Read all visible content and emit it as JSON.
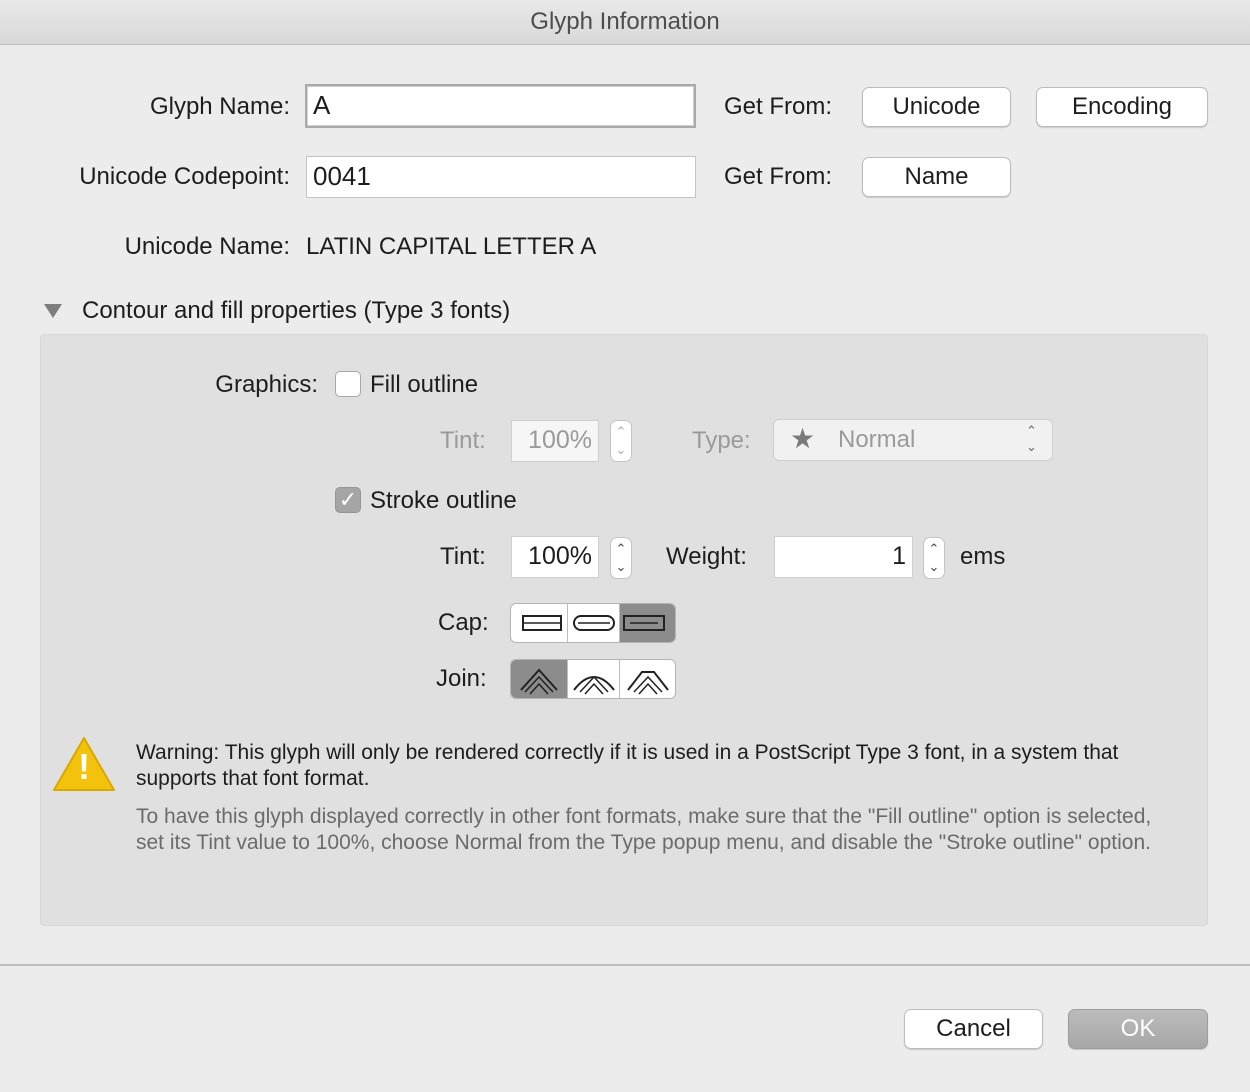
{
  "window": {
    "title": "Glyph Information"
  },
  "glyph_name": {
    "label": "Glyph Name:",
    "value": "A"
  },
  "get_from_1": {
    "label": "Get From:",
    "unicode_button": "Unicode",
    "encoding_button": "Encoding"
  },
  "codepoint": {
    "label": "Unicode Codepoint:",
    "value": "0041"
  },
  "get_from_2": {
    "label": "Get From:",
    "name_button": "Name"
  },
  "unicode_name": {
    "label": "Unicode Name:",
    "value": "LATIN CAPITAL LETTER A"
  },
  "section": {
    "title": "Contour and fill properties (Type 3 fonts)",
    "expanded": true
  },
  "graphics": {
    "label": "Graphics:",
    "fill_outline": {
      "label": "Fill outline",
      "checked": false
    },
    "fill_tint": {
      "label": "Tint:",
      "value": "100%"
    },
    "fill_type": {
      "label": "Type:",
      "value": "Normal",
      "icon": "star-icon"
    },
    "stroke_outline": {
      "label": "Stroke outline",
      "checked": true,
      "check_glyph": "✓"
    },
    "stroke_tint": {
      "label": "Tint:",
      "value": "100%"
    },
    "weight": {
      "label": "Weight:",
      "value": "1",
      "unit": "ems"
    },
    "cap": {
      "label": "Cap:",
      "options": [
        "butt-cap-icon",
        "round-cap-icon",
        "square-cap-icon"
      ],
      "selected": 2
    },
    "join": {
      "label": "Join:",
      "options": [
        "miter-join-icon",
        "round-join-icon",
        "bevel-join-icon"
      ],
      "selected": 0
    }
  },
  "warning": {
    "icon": "warning-icon",
    "icon_glyph": "!",
    "primary": "Warning: This glyph will only be rendered correctly if it is used in a PostScript Type 3 font, in a system that supports that font format.",
    "secondary": "To have this glyph displayed correctly in other font formats, make sure that the \"Fill outline\" option is selected, set its Tint value to 100%, choose Normal from the Type popup menu, and disable the \"Stroke outline\" option."
  },
  "buttons": {
    "cancel": "Cancel",
    "ok": "OK"
  },
  "glyphs": {
    "up": "⌃",
    "down": "⌄",
    "star": "★"
  }
}
